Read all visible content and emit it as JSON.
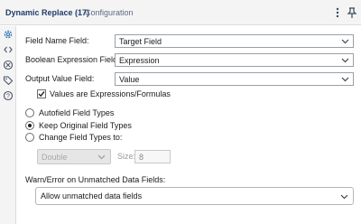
{
  "window": {
    "title": "Dynamic Replace (17)",
    "separator": "-",
    "subtitle": "Configuration"
  },
  "toolbar": {
    "icons": [
      "more-vertical-icon",
      "pin-icon"
    ]
  },
  "sidebar": {
    "icons": [
      "gear-icon",
      "code-icon",
      "no-entry-icon",
      "tag-icon",
      "help-icon"
    ],
    "active_color": "#2f6fb3"
  },
  "form": {
    "field_name": {
      "label": "Field Name Field:",
      "value": "Target Field"
    },
    "boolean_expression": {
      "label": "Boolean Expression Field:",
      "value": "Expression"
    },
    "output_value": {
      "label": "Output Value Field:",
      "value": "Value"
    },
    "values_are_expressions": {
      "label": "Values are Expressions/Formulas",
      "checked": true
    },
    "field_types": {
      "options": [
        {
          "label": "Autofield Field Types",
          "selected": false
        },
        {
          "label": "Keep Original Field Types",
          "selected": true
        },
        {
          "label": "Change Field Types to:",
          "selected": false
        }
      ],
      "type_value": "Double",
      "size_label": "Size:",
      "size_value": "8"
    },
    "warn_error": {
      "label": "Warn/Error on Unmatched Data Fields:",
      "value": "Allow unmatched data fields"
    }
  }
}
